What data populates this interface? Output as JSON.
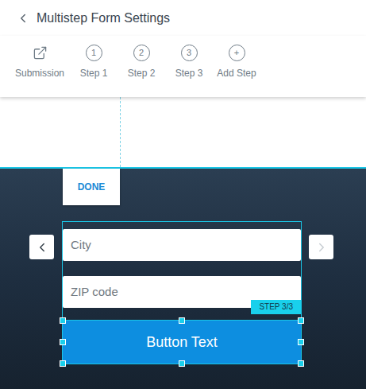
{
  "header": {
    "title": "Multistep Form Settings"
  },
  "tabs": [
    {
      "label": "Submission",
      "kind": "link",
      "selected": false
    },
    {
      "label": "Step 1",
      "kind": "step",
      "number": "1",
      "selected": false
    },
    {
      "label": "Step 2",
      "kind": "step",
      "number": "2",
      "selected": false
    },
    {
      "label": "Step 3",
      "kind": "step",
      "number": "3",
      "selected": false
    },
    {
      "label": "Add Step",
      "kind": "add",
      "glyph": "+",
      "selected": false
    }
  ],
  "done_button": "DONE",
  "form": {
    "fields": [
      {
        "placeholder": "City"
      },
      {
        "placeholder": "ZIP code"
      }
    ],
    "step_badge": "STEP 3/3",
    "button": {
      "label": "Button Text",
      "selected": true
    }
  },
  "nav": {
    "prev": {
      "disabled": false
    },
    "next": {
      "disabled": true
    }
  }
}
